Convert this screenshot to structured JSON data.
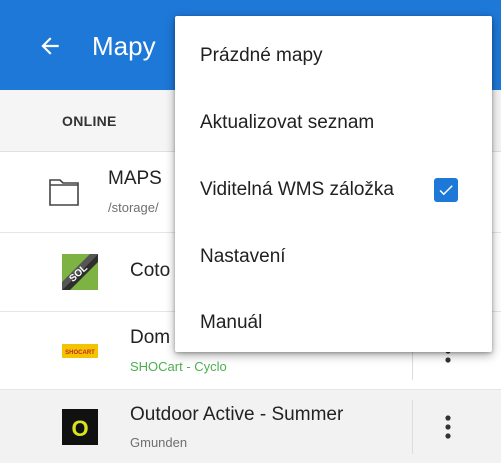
{
  "colors": {
    "accent": "#1e78d8",
    "subtitle_green": "#4caf50"
  },
  "appbar": {
    "title": "Mapy",
    "back_icon": "arrow-left-icon"
  },
  "tabs": [
    {
      "label": "ONLINE"
    }
  ],
  "list": {
    "folder": {
      "name": "MAPS",
      "path": "/storage/",
      "icon": "folder-icon"
    },
    "items": [
      {
        "title": "Coto",
        "subtitle": "",
        "icon": "sol-map-icon"
      },
      {
        "title": "Dom",
        "subtitle": "SHOCart - Cyclo",
        "icon": "shocart-logo-icon"
      },
      {
        "title": "Outdoor Active - Summer",
        "subtitle": "Gmunden",
        "icon": "outdoor-active-icon"
      }
    ]
  },
  "menu": {
    "items": [
      {
        "label": "Prázdné mapy"
      },
      {
        "label": "Aktualizovat seznam"
      },
      {
        "label": "Viditelná WMS záložka",
        "checked": true
      },
      {
        "label": "Nastavení"
      },
      {
        "label": "Manuál"
      }
    ]
  },
  "logos": {
    "shocart": "SHOCART",
    "sol": "SOL",
    "outdoor_active": "O"
  }
}
